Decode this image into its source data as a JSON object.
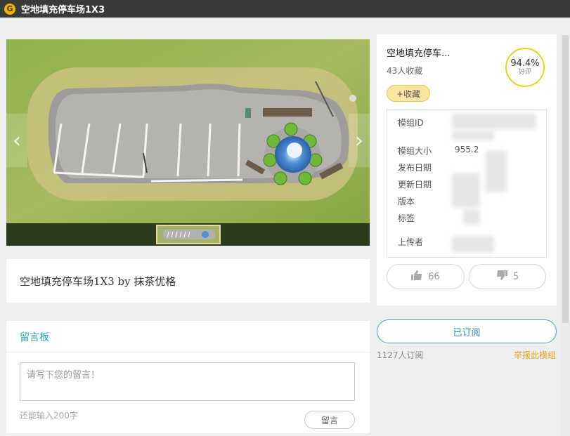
{
  "window": {
    "title": "空地填充停车场1X3"
  },
  "preview": {
    "prev_icon": "chevron-left-icon",
    "next_icon": "chevron-right-icon"
  },
  "model_name_line": "空地填充停车场1X3 by 抹茶优格",
  "info": {
    "title": "空地填充停车...",
    "favorites": "43人收藏",
    "rating": {
      "percent": "94.4%",
      "label": "好评",
      "ring_color": "#f0d21a"
    },
    "fav_button": "+收藏",
    "fields": [
      {
        "label": "模组ID",
        "value": ""
      },
      {
        "label": "模组大小",
        "value": "955.2"
      },
      {
        "label": "发布日期",
        "value": ""
      },
      {
        "label": "更新日期",
        "value": ""
      },
      {
        "label": "版本",
        "value": ""
      },
      {
        "label": "标签",
        "value": ""
      },
      {
        "label": "上传者",
        "value": ""
      }
    ],
    "likes": "66",
    "dislikes": "5"
  },
  "subscribe": {
    "button": "已订阅",
    "count": "1127人订阅",
    "report": "举报此模组",
    "accent": "#2a8fb8",
    "report_color": "#e3a21a"
  },
  "board": {
    "title": "留言板",
    "placeholder": "请写下您的留言！",
    "remaining": "还能输入200字",
    "post_button": "留言"
  }
}
